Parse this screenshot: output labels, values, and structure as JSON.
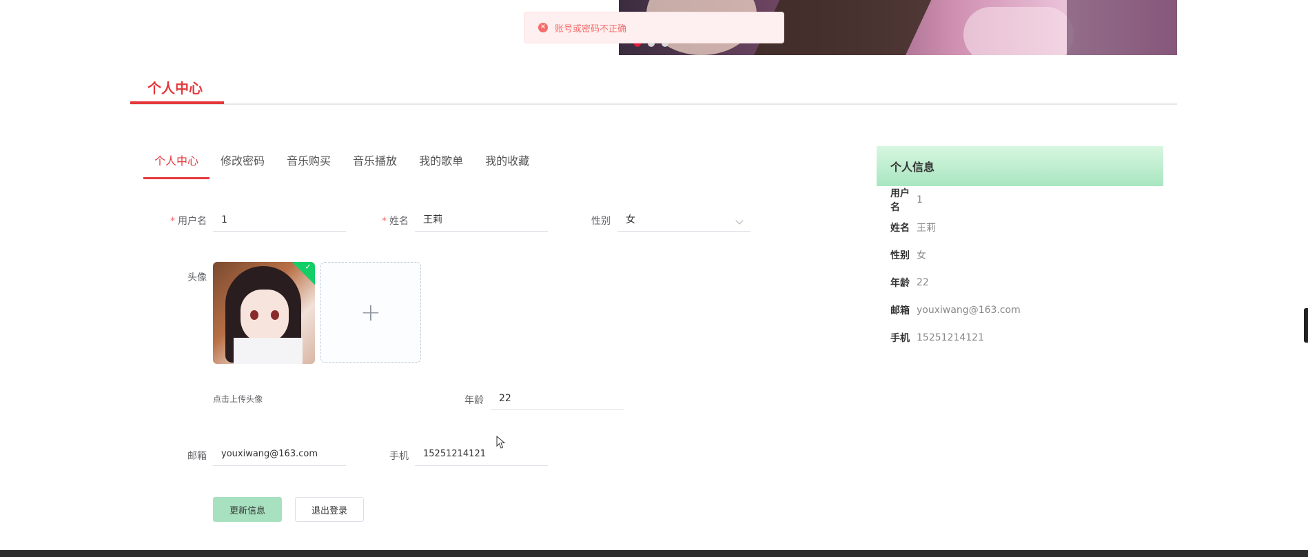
{
  "toast": {
    "message": "账号或密码不正确",
    "icon": "error-icon"
  },
  "banner": {
    "dots": [
      "active",
      "inactive",
      "inactive"
    ]
  },
  "page": {
    "title": "个人中心"
  },
  "tabs": [
    {
      "label": "个人中心",
      "active": true
    },
    {
      "label": "修改密码",
      "active": false
    },
    {
      "label": "音乐购买",
      "active": false
    },
    {
      "label": "音乐播放",
      "active": false
    },
    {
      "label": "我的歌单",
      "active": false
    },
    {
      "label": "我的收藏",
      "active": false
    }
  ],
  "form": {
    "username": {
      "label": "用户名",
      "value": "1",
      "required": "*"
    },
    "name": {
      "label": "姓名",
      "value": "王莉",
      "required": "*"
    },
    "gender": {
      "label": "性别",
      "value": "女"
    },
    "avatar": {
      "label": "头像",
      "hint": "点击上传头像",
      "upload_icon": "+"
    },
    "age": {
      "label": "年龄",
      "value": "22"
    },
    "email": {
      "label": "邮箱",
      "value": "youxiwang@163.com"
    },
    "phone": {
      "label": "手机",
      "value": "15251214121"
    },
    "update_button": "更新信息",
    "logout_button": "退出登录"
  },
  "info_card": {
    "title": "个人信息",
    "rows": [
      {
        "key": "用户名",
        "value": "1"
      },
      {
        "key": "姓名",
        "value": "王莉"
      },
      {
        "key": "性别",
        "value": "女"
      },
      {
        "key": "年龄",
        "value": "22"
      },
      {
        "key": "邮箱",
        "value": "youxiwang@163.com"
      },
      {
        "key": "手机",
        "value": "15251214121"
      }
    ]
  },
  "colors": {
    "accent": "#e4393c",
    "success": "#13ce66",
    "primary_button": "#a8e1c0",
    "error": "#f56c6c"
  }
}
